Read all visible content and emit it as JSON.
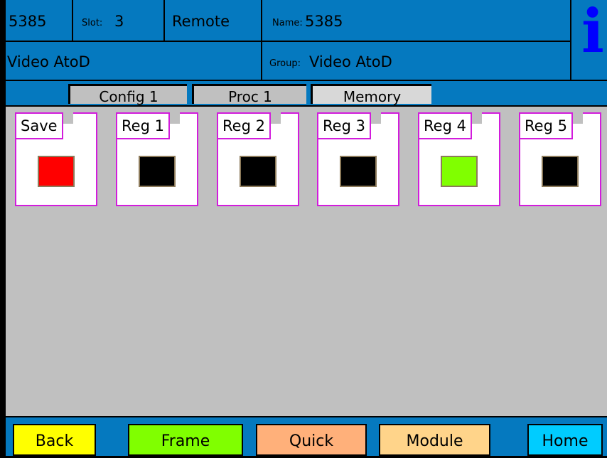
{
  "header": {
    "card_id": "5385",
    "slot_label": "Slot:",
    "slot_value": "3",
    "mode": "Remote",
    "name_label": "Name:",
    "name_value": "5385",
    "function": "Video AtoD",
    "group_label": "Group:",
    "group_value": "Video AtoD",
    "info_glyph": "i"
  },
  "tabs": [
    {
      "label": "Config 1",
      "state": "selected"
    },
    {
      "label": "Proc 1",
      "state": "selected"
    },
    {
      "label": "Memory",
      "state": "active"
    }
  ],
  "registers": [
    {
      "label": "Save",
      "color": "#ff0000"
    },
    {
      "label": "Reg 1",
      "color": "#000000"
    },
    {
      "label": "Reg 2",
      "color": "#000000"
    },
    {
      "label": "Reg 3",
      "color": "#000000"
    },
    {
      "label": "Reg 4",
      "color": "#80ff00"
    },
    {
      "label": "Reg 5",
      "color": "#000000"
    }
  ],
  "footer": {
    "back": {
      "label": "Back",
      "color": "#ffff00"
    },
    "frame": {
      "label": "Frame",
      "color": "#80ff00"
    },
    "quick": {
      "label": "Quick",
      "color": "#ffb07a"
    },
    "module": {
      "label": "Module",
      "color": "#ffd48a"
    },
    "home": {
      "label": "Home",
      "color": "#00ccff"
    }
  },
  "colors": {
    "header_bg": "#0579bf",
    "panel_bg": "#c0c0c0",
    "register_border": "#d21cdc",
    "info_icon": "#0000ff"
  }
}
